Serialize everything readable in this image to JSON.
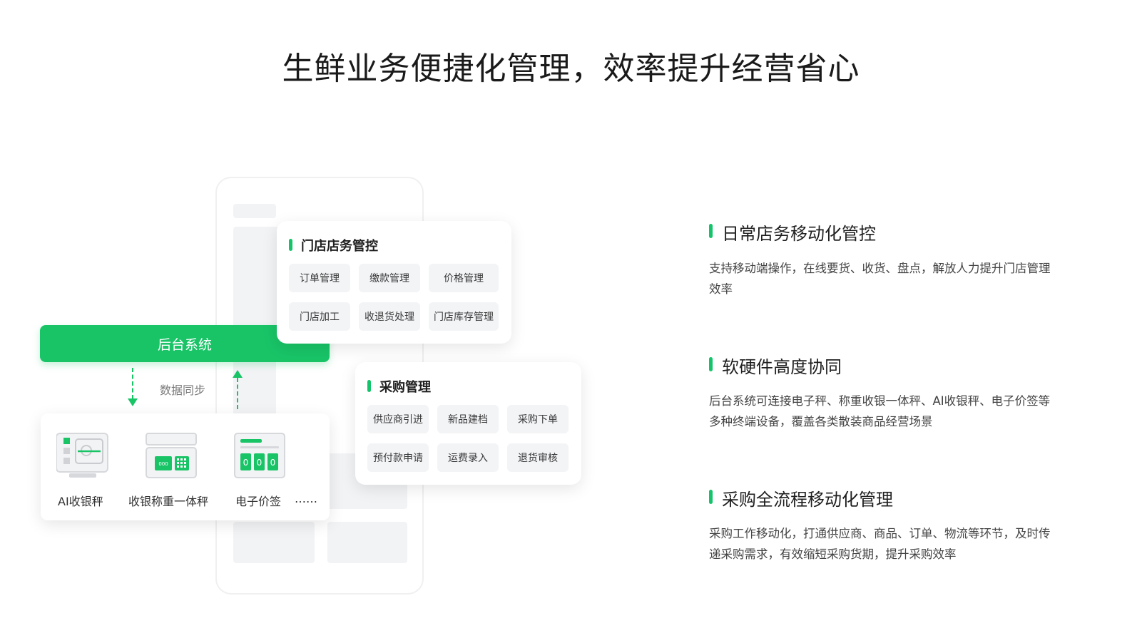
{
  "headline": "生鲜业务便捷化管理，效率提升经营省心",
  "colors": {
    "accent": "#19c467",
    "chip_bg": "#f3f4f6"
  },
  "store_card": {
    "title": "门店店务管控",
    "chips": [
      "订单管理",
      "缴款管理",
      "价格管理",
      "门店加工",
      "收退货处理",
      "门店库存管理"
    ]
  },
  "purchase_card": {
    "title": "采购管理",
    "chips": [
      "供应商引进",
      "新品建档",
      "采购下单",
      "预付款申请",
      "运费录入",
      "退货审核"
    ]
  },
  "backend": {
    "label": "后台系统",
    "sync_label": "数据同步"
  },
  "devices": [
    {
      "label": "AI收银秤",
      "icon": "ai-scale-icon"
    },
    {
      "label": "收银称重一体秤",
      "icon": "register-scale-icon"
    },
    {
      "label": "电子价签",
      "icon": "price-tag-icon"
    }
  ],
  "devices_more": "……",
  "features": [
    {
      "title": "日常店务移动化管控",
      "desc": "支持移动端操作，在线要货、收货、盘点，解放人力提升门店管理效率"
    },
    {
      "title": "软硬件高度协同",
      "desc": "后台系统可连接电子秤、称重收银一体秤、AI收银秤、电子价签等多种终端设备，覆盖各类散装商品经营场景"
    },
    {
      "title": "采购全流程移动化管理",
      "desc": "采购工作移动化，打通供应商、商品、订单、物流等环节，及时传递采购需求，有效缩短采购货期，提升采购效率"
    }
  ]
}
